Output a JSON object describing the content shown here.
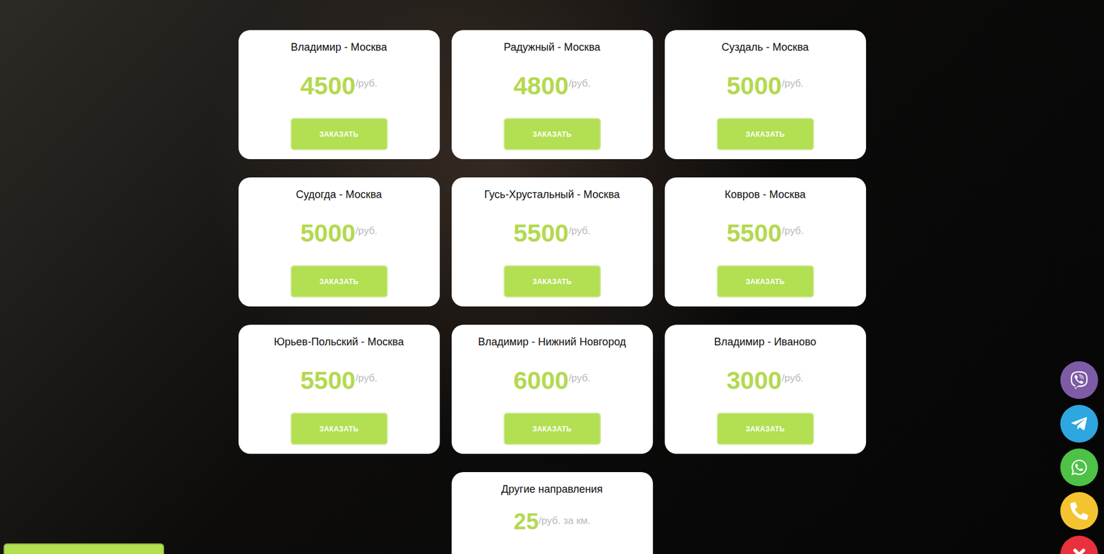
{
  "cards": [
    {
      "route": "Владимир - Москва",
      "price": "4500",
      "unit": "/руб.",
      "button": "ЗАКАЗАТЬ"
    },
    {
      "route": "Радужный - Москва",
      "price": "4800",
      "unit": "/руб.",
      "button": "ЗАКАЗАТЬ"
    },
    {
      "route": "Суздаль - Москва",
      "price": "5000",
      "unit": "/руб.",
      "button": "ЗАКАЗАТЬ"
    },
    {
      "route": "Судогда - Москва",
      "price": "5000",
      "unit": "/руб.",
      "button": "ЗАКАЗАТЬ"
    },
    {
      "route": "Гусь-Хрустальный - Москва",
      "price": "5500",
      "unit": "/руб.",
      "button": "ЗАКАЗАТЬ"
    },
    {
      "route": "Ковров - Москва",
      "price": "5500",
      "unit": "/руб.",
      "button": "ЗАКАЗАТЬ"
    },
    {
      "route": "Юрьев-Польский - Москва",
      "price": "5500",
      "unit": "/руб.",
      "button": "ЗАКАЗАТЬ"
    },
    {
      "route": "Владимир - Нижний Новгород",
      "price": "6000",
      "unit": "/руб.",
      "button": "ЗАКАЗАТЬ"
    },
    {
      "route": "Владимир - Иваново",
      "price": "3000",
      "unit": "/руб.",
      "button": "ЗАКАЗАТЬ"
    }
  ],
  "other": {
    "route": "Другие направления",
    "price": "25",
    "unit": "/руб. за км."
  }
}
